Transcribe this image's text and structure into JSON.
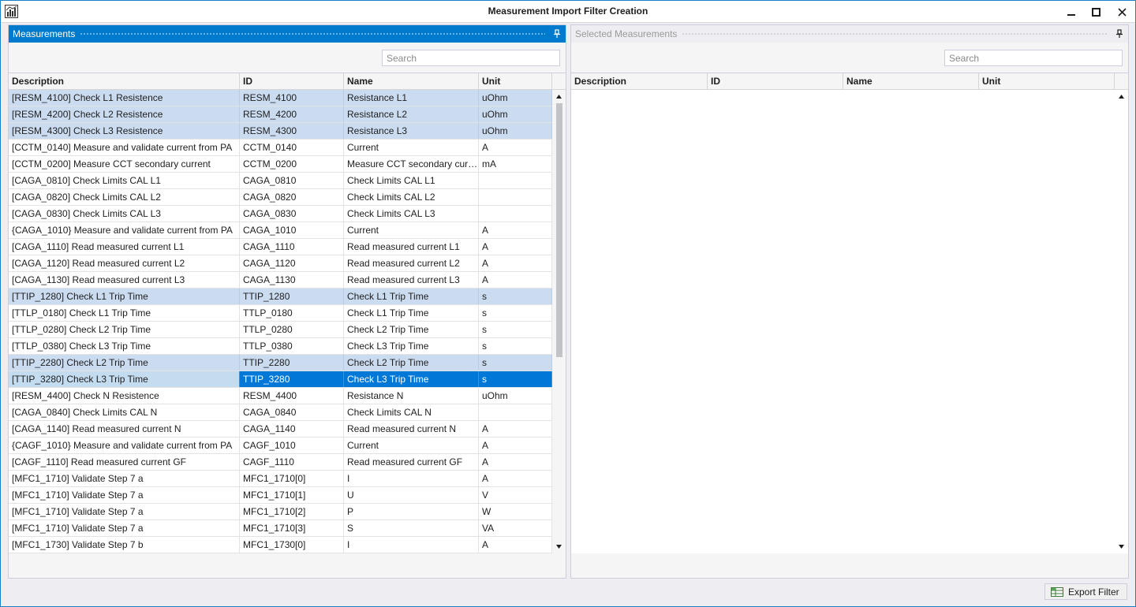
{
  "window": {
    "title": "Measurement Import Filter Creation"
  },
  "left_panel": {
    "title": "Measurements",
    "search_placeholder": "Search",
    "columns": [
      "Description",
      "ID",
      "Name",
      "Unit"
    ],
    "rows": [
      {
        "description": "[RESM_4100] Check L1 Resistence",
        "id": "RESM_4100",
        "name": "Resistance L1",
        "unit": "uOhm",
        "state": "selected"
      },
      {
        "description": "[RESM_4200] Check L2 Resistence",
        "id": "RESM_4200",
        "name": "Resistance L2",
        "unit": "uOhm",
        "state": "selected"
      },
      {
        "description": "[RESM_4300] Check L3 Resistence",
        "id": "RESM_4300",
        "name": "Resistance L3",
        "unit": "uOhm",
        "state": "selected"
      },
      {
        "description": "[CCTM_0140] Measure and validate current from PA",
        "id": "CCTM_0140",
        "name": "Current",
        "unit": "A",
        "state": ""
      },
      {
        "description": "[CCTM_0200] Measure CCT secondary current",
        "id": "CCTM_0200",
        "name": "Measure CCT secondary current",
        "unit": "mA",
        "state": ""
      },
      {
        "description": "[CAGA_0810] Check Limits CAL L1",
        "id": "CAGA_0810",
        "name": "Check Limits CAL L1",
        "unit": "",
        "state": ""
      },
      {
        "description": "[CAGA_0820] Check Limits CAL L2",
        "id": "CAGA_0820",
        "name": "Check Limits CAL L2",
        "unit": "",
        "state": ""
      },
      {
        "description": "[CAGA_0830] Check Limits CAL L3",
        "id": "CAGA_0830",
        "name": "Check Limits CAL L3",
        "unit": "",
        "state": ""
      },
      {
        "description": "{CAGA_1010} Measure and validate current from PA",
        "id": "CAGA_1010",
        "name": "Current",
        "unit": "A",
        "state": ""
      },
      {
        "description": "[CAGA_1110] Read measured current L1",
        "id": "CAGA_1110",
        "name": "Read measured current L1",
        "unit": "A",
        "state": ""
      },
      {
        "description": "[CAGA_1120] Read measured current L2",
        "id": "CAGA_1120",
        "name": "Read measured current L2",
        "unit": "A",
        "state": ""
      },
      {
        "description": "[CAGA_1130] Read measured current L3",
        "id": "CAGA_1130",
        "name": "Read measured current L3",
        "unit": "A",
        "state": ""
      },
      {
        "description": "[TTIP_1280] Check L1 Trip Time",
        "id": "TTIP_1280",
        "name": "Check L1 Trip Time",
        "unit": "s",
        "state": "selected"
      },
      {
        "description": "[TTLP_0180] Check L1 Trip Time",
        "id": "TTLP_0180",
        "name": "Check L1 Trip Time",
        "unit": "s",
        "state": ""
      },
      {
        "description": "[TTLP_0280] Check L2 Trip Time",
        "id": "TTLP_0280",
        "name": "Check L2 Trip Time",
        "unit": "s",
        "state": ""
      },
      {
        "description": "[TTLP_0380] Check L3 Trip Time",
        "id": "TTLP_0380",
        "name": "Check L3 Trip Time",
        "unit": "s",
        "state": ""
      },
      {
        "description": "[TTIP_2280] Check L2 Trip Time",
        "id": "TTIP_2280",
        "name": "Check L2 Trip Time",
        "unit": "s",
        "state": "selected"
      },
      {
        "description": "[TTIP_3280] Check L3 Trip Time",
        "id": "TTIP_3280",
        "name": "Check L3 Trip Time",
        "unit": "s",
        "state": "current"
      },
      {
        "description": "[RESM_4400] Check N Resistence",
        "id": "RESM_4400",
        "name": "Resistance N",
        "unit": "uOhm",
        "state": ""
      },
      {
        "description": "[CAGA_0840] Check Limits CAL N",
        "id": "CAGA_0840",
        "name": "Check Limits CAL N",
        "unit": "",
        "state": ""
      },
      {
        "description": "[CAGA_1140] Read measured current N",
        "id": "CAGA_1140",
        "name": "Read measured current N",
        "unit": "A",
        "state": ""
      },
      {
        "description": "{CAGF_1010} Measure and validate current from PA",
        "id": "CAGF_1010",
        "name": "Current",
        "unit": "A",
        "state": ""
      },
      {
        "description": "[CAGF_1110] Read measured current GF",
        "id": "CAGF_1110",
        "name": "Read measured current GF",
        "unit": "A",
        "state": ""
      },
      {
        "description": "[MFC1_1710] Validate Step 7 a",
        "id": "MFC1_1710[0]",
        "name": "I",
        "unit": "A",
        "state": ""
      },
      {
        "description": "[MFC1_1710] Validate Step 7 a",
        "id": "MFC1_1710[1]",
        "name": "U",
        "unit": "V",
        "state": ""
      },
      {
        "description": "[MFC1_1710] Validate Step 7 a",
        "id": "MFC1_1710[2]",
        "name": "P",
        "unit": "W",
        "state": ""
      },
      {
        "description": "[MFC1_1710] Validate Step 7 a",
        "id": "MFC1_1710[3]",
        "name": "S",
        "unit": "VA",
        "state": ""
      },
      {
        "description": "[MFC1_1730] Validate Step 7 b",
        "id": "MFC1_1730[0]",
        "name": "I",
        "unit": "A",
        "state": ""
      }
    ]
  },
  "right_panel": {
    "title": "Selected Measurements",
    "search_placeholder": "Search",
    "columns": [
      "Description",
      "ID",
      "Name",
      "Unit"
    ],
    "rows": []
  },
  "footer": {
    "export_label": "Export Filter"
  },
  "colors": {
    "accent": "#007acc",
    "selected_row": "#cbdcf1",
    "current_row": "#0078d7"
  }
}
